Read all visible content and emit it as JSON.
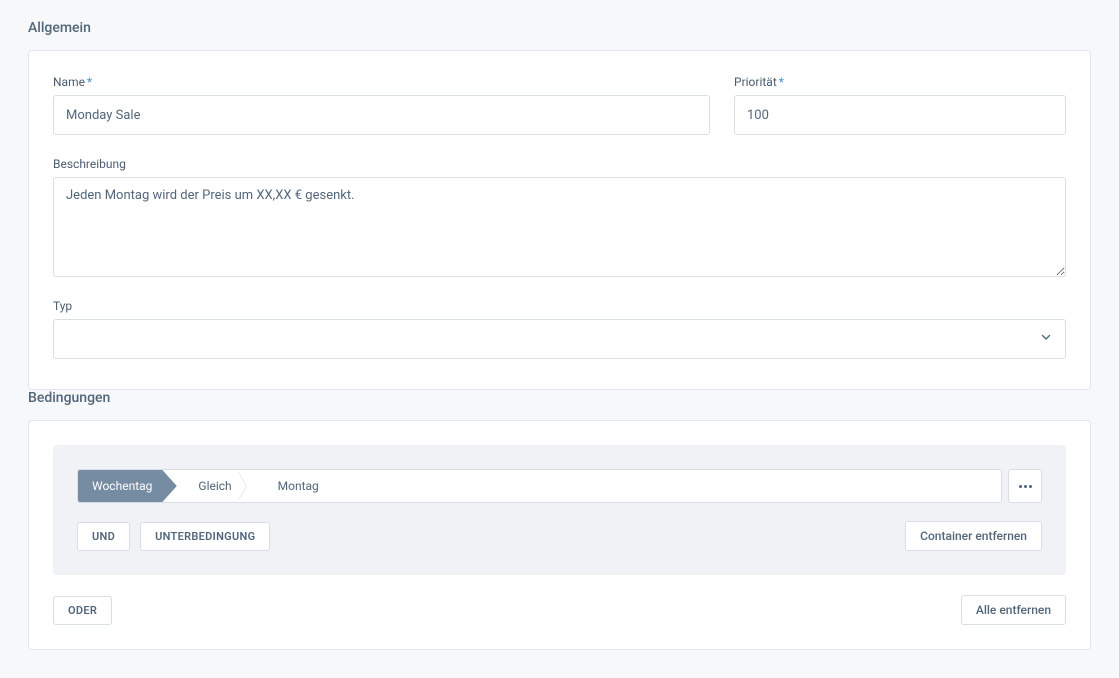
{
  "sections": {
    "general": {
      "title": "Allgemein",
      "name_label": "Name",
      "name_value": "Monday Sale",
      "priority_label": "Priorität",
      "priority_value": "100",
      "description_label": "Beschreibung",
      "description_value": "Jeden Montag wird der Preis um XX,XX € gesenkt.",
      "type_label": "Typ",
      "type_value": ""
    },
    "conditions": {
      "title": "Bedingungen",
      "rule": {
        "field": "Wochentag",
        "operator": "Gleich",
        "value": "Montag"
      },
      "buttons": {
        "and": "UND",
        "subcondition": "UNTERBEDINGUNG",
        "remove_container": "Container entfernen",
        "or": "ODER",
        "remove_all": "Alle entfernen"
      }
    }
  },
  "required_marker": "*"
}
